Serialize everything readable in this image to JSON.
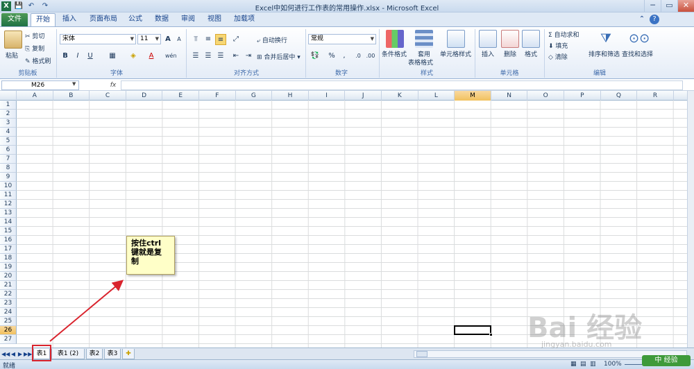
{
  "window": {
    "title": "Excel中如何进行工作表的常用操作.xlsx - Microsoft Excel",
    "min": "─",
    "max": "▭",
    "close": "✕"
  },
  "qat": {
    "excel_icon": "X",
    "save": "💾",
    "undo": "↶",
    "redo": "↷"
  },
  "tabs": [
    {
      "label": "文件"
    },
    {
      "label": "开始"
    },
    {
      "label": "插入"
    },
    {
      "label": "页面布局"
    },
    {
      "label": "公式"
    },
    {
      "label": "数据"
    },
    {
      "label": "审阅"
    },
    {
      "label": "视图"
    },
    {
      "label": "加载项"
    }
  ],
  "ribbon": {
    "clipboard": {
      "paste": "粘贴",
      "cut": "剪切",
      "copy": "复制",
      "format_painter": "格式刷",
      "label": "剪贴板"
    },
    "font": {
      "name": "宋体",
      "size": "11",
      "grow": "A",
      "shrink": "A",
      "bold": "B",
      "italic": "I",
      "underline": "U",
      "phonetic": "wén",
      "label": "字体"
    },
    "alignment": {
      "wrap": "自动换行",
      "merge": "合并后居中",
      "label": "对齐方式"
    },
    "number": {
      "format": "常规",
      "percent": "%",
      "comma": ",",
      "label": "数字"
    },
    "styles": {
      "conditional": "条件格式",
      "table_1": "套用",
      "table_2": "表格格式",
      "cell_styles": "单元格样式",
      "label": "样式"
    },
    "cells": {
      "insert": "插入",
      "delete": "删除",
      "format": "格式",
      "label": "单元格"
    },
    "editing": {
      "autosum": "Σ 自动求和",
      "fill": "填充",
      "clear": "清除",
      "sort": "排序和筛选",
      "find": "查找和选择",
      "label": "编辑"
    }
  },
  "formula_bar": {
    "name_box": "M26",
    "fx": "fx",
    "value": ""
  },
  "columns": [
    "A",
    "B",
    "C",
    "D",
    "E",
    "F",
    "G",
    "H",
    "I",
    "J",
    "K",
    "L",
    "M",
    "N",
    "O",
    "P",
    "Q",
    "R"
  ],
  "rows": [
    "1",
    "2",
    "3",
    "4",
    "5",
    "6",
    "7",
    "8",
    "9",
    "10",
    "11",
    "12",
    "13",
    "14",
    "15",
    "16",
    "17",
    "18",
    "19",
    "20",
    "21",
    "22",
    "23",
    "24",
    "25",
    "26",
    "27"
  ],
  "active_cell": {
    "column": "M",
    "row": "26"
  },
  "sheets": [
    {
      "label": "表1",
      "active": true
    },
    {
      "label": "表1 (2)",
      "active": false
    },
    {
      "label": "表2",
      "active": false
    },
    {
      "label": "表3",
      "active": false
    }
  ],
  "sheet_nav": [
    "◀◀",
    "◀",
    "▶",
    "▶▶"
  ],
  "status": {
    "ready": "就绪",
    "zoom": "100%"
  },
  "callout": {
    "text": "按住ctrl\n键就是复\n制"
  },
  "watermark": {
    "brand": "Bai 经验",
    "sub": "jingyan.baidu.com",
    "corner": "中 经验"
  },
  "colors": {
    "accent": "#1e7145",
    "selected_header": "#f1c15f",
    "annotation": "#d9232d",
    "callout_bg": "#ffffc8"
  }
}
